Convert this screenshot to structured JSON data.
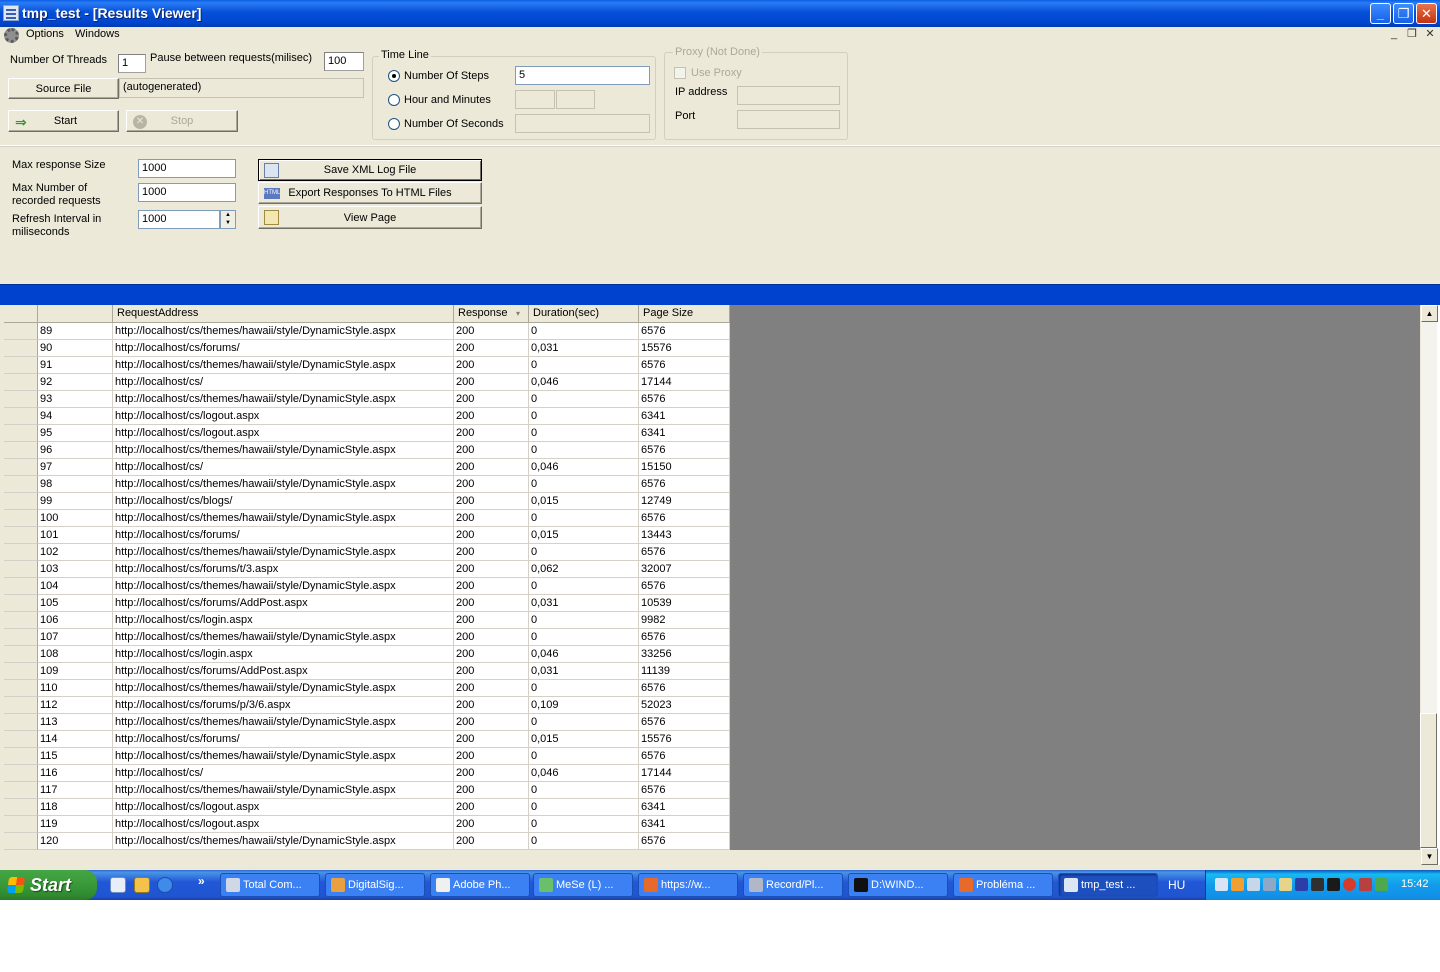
{
  "window": {
    "title": "tmp_test - [Results Viewer]",
    "minimize": "_",
    "maximize": "❐",
    "close": "✕"
  },
  "menu": {
    "options": "Options",
    "windows": "Windows",
    "mdi_min": "_",
    "mdi_restore": "❐",
    "mdi_close": "✕"
  },
  "settings": {
    "threads_label": "Number Of Threads",
    "threads_value": "1",
    "pause_label": "Pause between requests(milisec)",
    "pause_value": "100",
    "source_file_button": "Source File",
    "source_file_value": "(autogenerated)",
    "start_button": "Start",
    "stop_button": "Stop"
  },
  "timeline": {
    "title": "Time Line",
    "steps_label": "Number Of Steps",
    "steps_value": "5",
    "hours_label": "Hour and Minutes",
    "seconds_label": "Number Of Seconds"
  },
  "proxy": {
    "title": "Proxy (Not Done)",
    "use_proxy_label": "Use Proxy",
    "ip_label": "IP address",
    "port_label": "Port"
  },
  "limits": {
    "max_response_label": "Max response Size",
    "max_response_value": "1000",
    "max_recorded_label_1": "Max Number of",
    "max_recorded_label_2": "recorded requests",
    "max_recorded_value": "1000",
    "refresh_label_1": "Refresh Interval in",
    "refresh_label_2": "miliseconds",
    "refresh_value": "1000"
  },
  "actions": {
    "save_xml": "Save XML Log File",
    "export_html": "Export Responses To HTML Files",
    "view_page": "View Page"
  },
  "grid": {
    "columns": [
      "",
      "",
      "RequestAddress",
      "Response",
      "Duration(sec)",
      "Page Size"
    ],
    "rows": [
      [
        "89",
        "http://localhost/cs/themes/hawaii/style/DynamicStyle.aspx",
        "200",
        "0",
        "6576"
      ],
      [
        "90",
        "http://localhost/cs/forums/",
        "200",
        "0,031",
        "15576"
      ],
      [
        "91",
        "http://localhost/cs/themes/hawaii/style/DynamicStyle.aspx",
        "200",
        "0",
        "6576"
      ],
      [
        "92",
        "http://localhost/cs/",
        "200",
        "0,046",
        "17144"
      ],
      [
        "93",
        "http://localhost/cs/themes/hawaii/style/DynamicStyle.aspx",
        "200",
        "0",
        "6576"
      ],
      [
        "94",
        "http://localhost/cs/logout.aspx",
        "200",
        "0",
        "6341"
      ],
      [
        "95",
        "http://localhost/cs/logout.aspx",
        "200",
        "0",
        "6341"
      ],
      [
        "96",
        "http://localhost/cs/themes/hawaii/style/DynamicStyle.aspx",
        "200",
        "0",
        "6576"
      ],
      [
        "97",
        "http://localhost/cs/",
        "200",
        "0,046",
        "15150"
      ],
      [
        "98",
        "http://localhost/cs/themes/hawaii/style/DynamicStyle.aspx",
        "200",
        "0",
        "6576"
      ],
      [
        "99",
        "http://localhost/cs/blogs/",
        "200",
        "0,015",
        "12749"
      ],
      [
        "100",
        "http://localhost/cs/themes/hawaii/style/DynamicStyle.aspx",
        "200",
        "0",
        "6576"
      ],
      [
        "101",
        "http://localhost/cs/forums/",
        "200",
        "0,015",
        "13443"
      ],
      [
        "102",
        "http://localhost/cs/themes/hawaii/style/DynamicStyle.aspx",
        "200",
        "0",
        "6576"
      ],
      [
        "103",
        "http://localhost/cs/forums/t/3.aspx",
        "200",
        "0,062",
        "32007"
      ],
      [
        "104",
        "http://localhost/cs/themes/hawaii/style/DynamicStyle.aspx",
        "200",
        "0",
        "6576"
      ],
      [
        "105",
        "http://localhost/cs/forums/AddPost.aspx",
        "200",
        "0,031",
        "10539"
      ],
      [
        "106",
        "http://localhost/cs/login.aspx",
        "200",
        "0",
        "9982"
      ],
      [
        "107",
        "http://localhost/cs/themes/hawaii/style/DynamicStyle.aspx",
        "200",
        "0",
        "6576"
      ],
      [
        "108",
        "http://localhost/cs/login.aspx",
        "200",
        "0,046",
        "33256"
      ],
      [
        "109",
        "http://localhost/cs/forums/AddPost.aspx",
        "200",
        "0,031",
        "11139"
      ],
      [
        "110",
        "http://localhost/cs/themes/hawaii/style/DynamicStyle.aspx",
        "200",
        "0",
        "6576"
      ],
      [
        "112",
        "http://localhost/cs/forums/p/3/6.aspx",
        "200",
        "0,109",
        "52023"
      ],
      [
        "113",
        "http://localhost/cs/themes/hawaii/style/DynamicStyle.aspx",
        "200",
        "0",
        "6576"
      ],
      [
        "114",
        "http://localhost/cs/forums/",
        "200",
        "0,015",
        "15576"
      ],
      [
        "115",
        "http://localhost/cs/themes/hawaii/style/DynamicStyle.aspx",
        "200",
        "0",
        "6576"
      ],
      [
        "116",
        "http://localhost/cs/",
        "200",
        "0,046",
        "17144"
      ],
      [
        "117",
        "http://localhost/cs/themes/hawaii/style/DynamicStyle.aspx",
        "200",
        "0",
        "6576"
      ],
      [
        "118",
        "http://localhost/cs/logout.aspx",
        "200",
        "0",
        "6341"
      ],
      [
        "119",
        "http://localhost/cs/logout.aspx",
        "200",
        "0",
        "6341"
      ],
      [
        "120",
        "http://localhost/cs/themes/hawaii/style/DynamicStyle.aspx",
        "200",
        "0",
        "6576"
      ]
    ]
  },
  "taskbar": {
    "start": "Start",
    "expand": "»",
    "tasks": [
      "Total Com...",
      "DigitalSig...",
      "Adobe Ph...",
      "MeSe (L) ...",
      "https://w...",
      "Record/Pl...",
      "D:\\WIND...",
      "Probléma ...",
      "tmp_test ..."
    ],
    "language": "HU",
    "clock": "15:42"
  },
  "colors": {
    "title_bar": "#0550d8",
    "dialog_bg": "#ece9d8",
    "blue_strip": "#0042cd",
    "grid_empty": "#808080",
    "start_green": "#3c9c3c"
  }
}
